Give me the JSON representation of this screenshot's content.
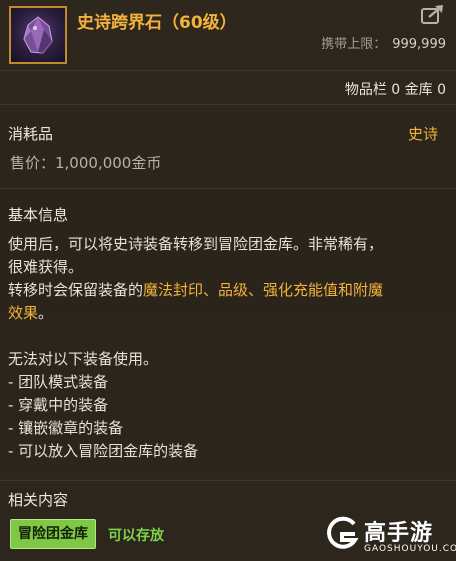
{
  "item": {
    "name": "史诗跨界石（60级）",
    "carry_label": "携带上限：",
    "carry_value": "999,999",
    "inventory_text": "物品栏 0 金库 0",
    "category": "消耗品",
    "rarity": "史诗",
    "price": "售价：1,000,000金币",
    "rarity_color": "#f3b23a",
    "frame_color": "#c08a2e"
  },
  "basic_info": {
    "heading": "基本信息",
    "line1": "使用后，可以将史诗装备转移到冒险团金库。非常稀有，",
    "line2": "很难获得。",
    "line3_prefix": "转移时会保留装备的",
    "line3_highlight": "魔法封印、品级、强化充能值和附魔",
    "line4_highlight": "效果",
    "line4_suffix": "。",
    "restriction_title": "无法对以下装备使用。",
    "restrictions": [
      "- 团队模式装备",
      "- 穿戴中的装备",
      "- 镶嵌徽章的装备",
      "- 可以放入冒险团金库的装备"
    ]
  },
  "related": {
    "heading": "相关内容",
    "badge_label": "冒险团金库",
    "badge_note": "可以存放",
    "badge_color": "#7fc845"
  },
  "watermark": {
    "text": "高手游",
    "url": "GAOSHOUYOU.COM"
  },
  "icons": {
    "item": "epic-crystal-icon",
    "share": "share-arrow-icon",
    "logo": "gaoshouyou-logo-icon"
  }
}
